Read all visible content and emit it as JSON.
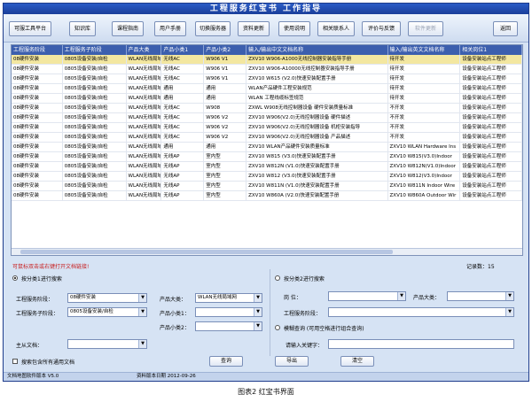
{
  "window": {
    "title": "工程服务红宝书    工作指导"
  },
  "toolbar": {
    "buttons": [
      "可服工具平台",
      "知识库",
      "课程指南",
      "用户手册",
      "切换服务器",
      "资料更新",
      "使用说明",
      "相关联系人",
      "评价与反馈",
      "软件更新"
    ],
    "back_label": "返回"
  },
  "grid": {
    "columns": [
      "工程服务阶段",
      "工程服务子阶段",
      "产品大类",
      "产品小类1",
      "产品小类2",
      "输入/输出中文文档名称",
      "输入/输出英文文档名称",
      "相关岗位1"
    ],
    "rows": [
      [
        "08硬件安装",
        "0805设备安装/自检",
        "WLAN无线局域网",
        "无线AC",
        "W906 V1",
        "ZXV10 W906-A1000无线控制器安装指导手册",
        "待开发",
        "设备安装站点工程师"
      ],
      [
        "08硬件安装",
        "0805设备安装/自检",
        "WLAN无线局域网",
        "无线AC",
        "W906 V1",
        "ZXV10 W906-A10000无线控制器安装指导手册",
        "待开发",
        "设备安装站点工程师"
      ],
      [
        "08硬件安装",
        "0805设备安装/自检",
        "WLAN无线局域网",
        "无线AC",
        "W906 V1",
        "ZXV10 W615 (V2.0)快速安装配置手册",
        "待开发",
        "设备安装站点工程师"
      ],
      [
        "08硬件安装",
        "0805设备安装/自检",
        "WLAN无线局域网",
        "通用",
        "通用",
        "WLAN产品硬件工程安装规范",
        "待开发",
        "设备安装站点工程师"
      ],
      [
        "08硬件安装",
        "0805设备安装/自检",
        "WLAN无线局域网",
        "通用",
        "通用",
        "WLAN 工程线缆标签规范",
        "待开发",
        "设备安装站点工程师"
      ],
      [
        "08硬件安装",
        "0805设备安装/自检",
        "WLAN无线局域网",
        "无线AC",
        "W908",
        "ZXWL W908无线控制器设备 硬件安装质量标准",
        "不开发",
        "设备安装站点工程师"
      ],
      [
        "08硬件安装",
        "0805设备安装/自检",
        "WLAN无线局域网",
        "无线AC",
        "W906 V2",
        "ZXV10 W906(V2.0)无线控制器设备 硬件描述",
        "不开发",
        "设备安装站点工程师"
      ],
      [
        "08硬件安装",
        "0805设备安装/自检",
        "WLAN无线局域网",
        "无线AC",
        "W906 V2",
        "ZXV10 W906(V2.0)无线控制器设备 机柜安装指导",
        "不开发",
        "设备安装站点工程师"
      ],
      [
        "08硬件安装",
        "0805设备安装/自检",
        "WLAN无线局域网",
        "无线AC",
        "W906 V2",
        "ZXV10 W906(V2.0)无线控制器设备 产品描述",
        "不开发",
        "设备安装站点工程师"
      ],
      [
        "08硬件安装",
        "0805设备安装/自检",
        "WLAN无线局域网",
        "通用",
        "通用",
        "ZXV10 WLAN产品硬件安装质量标准",
        "ZXV10 WLAN Hardware Ins",
        "设备安装站点工程师"
      ],
      [
        "08硬件安装",
        "0805设备安装/自检",
        "WLAN无线局域网",
        "无线AP",
        "室内型",
        "ZXV10 W815 (V3.0)快速安装配置手册",
        "ZXV10 W815(V3.0)Indoor",
        "设备安装站点工程师"
      ],
      [
        "08硬件安装",
        "0805设备安装/自检",
        "WLAN无线局域网",
        "无线AP",
        "室内型",
        "ZXV10 W812N (V1.0)快速安装配置手册",
        "ZXV10 W812N(V1.0)Indoor",
        "设备安装站点工程师"
      ],
      [
        "08硬件安装",
        "0805设备安装/自检",
        "WLAN无线局域网",
        "无线AP",
        "室内型",
        "ZXV10 W812 (V3.0)快速安装配置手册",
        "ZXV10 W812(V3.0)Indoor",
        "设备安装站点工程师"
      ],
      [
        "08硬件安装",
        "0805设备安装/自检",
        "WLAN无线局域网",
        "无线AP",
        "室内型",
        "ZXV10 W811N (V1.0)快速安装配置手册",
        "ZXV10 W811N Indoor Wire",
        "设备安装站点工程师"
      ],
      [
        "08硬件安装",
        "0805设备安装/自检",
        "WLAN无线局域网",
        "无线AP",
        "室内型",
        "ZXV10 W860A (V2.0)快速安装配置手册",
        "ZXV10 W860A Outdoor Wir",
        "设备安装站点工程师"
      ]
    ]
  },
  "hint": "可鼠标双击或右键打开文档链接!",
  "record_count": "记录数：15",
  "left_search": {
    "radio_label": "按分类1进行搜索",
    "stage_label": "工程服务阶段：",
    "stage_value": "08硬件安装",
    "substage_label": "工程服务子阶段：",
    "substage_value": "0805设备安装/自检",
    "major_label": "产品大类：",
    "major_value": "WLAN无线局域网",
    "minor1_label": "产品小类1：",
    "minor1_value": "",
    "minor2_label": "产品小类2：",
    "minor2_value": "",
    "doc_label": "主从文档：",
    "doc_value": "",
    "include_general_label": "搜索包含所有通用文档"
  },
  "right_search": {
    "radio_label": "按分类2进行搜索",
    "post_label": "岗        位：",
    "post_value": "",
    "major_label": "产品大类：",
    "major_value": "",
    "stage_label": "工程服务阶段：",
    "stage_value": "",
    "fuzzy_label": "模糊查询 (可用空格进行组合查询)",
    "keyword_label": "请输入关键字："
  },
  "actions": {
    "search": "查询",
    "export": "导出",
    "clear": "清空"
  },
  "status": {
    "doc_version": "文档地图软件版本  V5.0",
    "data_version": "资料版本日期  2012-09-26"
  },
  "caption": "图表2    红宝书界面"
}
